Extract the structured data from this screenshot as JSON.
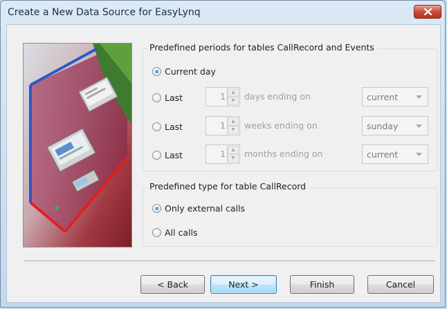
{
  "window": {
    "title": "Create a New Data Source for EasyLynq"
  },
  "periods_group": {
    "legend": "Predefined periods for tables CallRecord and Events",
    "current_day_label": "Current day",
    "rows": [
      {
        "radio_label": "Last",
        "spin_value": "1",
        "suffix": "days ending on",
        "combo_value": "current"
      },
      {
        "radio_label": "Last",
        "spin_value": "1",
        "suffix": "weeks ending on",
        "combo_value": "sunday"
      },
      {
        "radio_label": "Last",
        "spin_value": "1",
        "suffix": "months ending on",
        "combo_value": "current"
      }
    ],
    "selected": "Current day"
  },
  "type_group": {
    "legend": "Predefined type for table CallRecord",
    "options": [
      "Only external calls",
      "All calls"
    ],
    "selected": "Only external calls"
  },
  "buttons": {
    "back": "< Back",
    "next": "Next >",
    "finish": "Finish",
    "cancel": "Cancel"
  },
  "colors": {
    "title_bar": "#dce9f5",
    "close_button": "#c84a35",
    "dialog_background": "#f0f0f0",
    "default_button": "#bee6fd"
  }
}
